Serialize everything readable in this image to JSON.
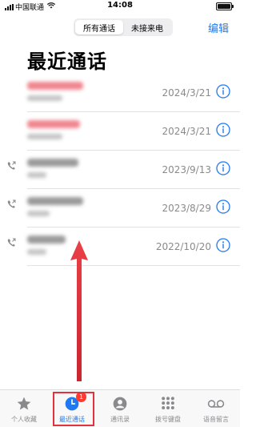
{
  "status_bar": {
    "carrier": "中国联通",
    "time": "14:08",
    "battery_level": 1.0
  },
  "header": {
    "tabs": [
      {
        "label": "所有通话",
        "selected": true
      },
      {
        "label": "未接来电",
        "selected": false
      }
    ],
    "edit_label": "编辑",
    "title": "最近通话"
  },
  "calls": [
    {
      "date": "2024/3/21",
      "missed": true,
      "outgoing": false
    },
    {
      "date": "2024/3/21",
      "missed": true,
      "outgoing": false
    },
    {
      "date": "2023/9/13",
      "missed": false,
      "outgoing": true
    },
    {
      "date": "2023/8/29",
      "missed": false,
      "outgoing": true
    },
    {
      "date": "2022/10/20",
      "missed": false,
      "outgoing": true
    }
  ],
  "tab_bar": {
    "items": [
      {
        "label": "个人收藏",
        "icon": "star-icon",
        "active": false
      },
      {
        "label": "最近通话",
        "icon": "clock-icon",
        "active": true,
        "badge": "1"
      },
      {
        "label": "通讯录",
        "icon": "contact-icon",
        "active": false
      },
      {
        "label": "拨号键盘",
        "icon": "keypad-icon",
        "active": false
      },
      {
        "label": "语音留言",
        "icon": "voicemail-icon",
        "active": false
      }
    ]
  },
  "colors": {
    "accent": "#1f79f2",
    "missed": "#f0868e",
    "annotation": "#e3323c",
    "badge": "#ff3b30"
  }
}
